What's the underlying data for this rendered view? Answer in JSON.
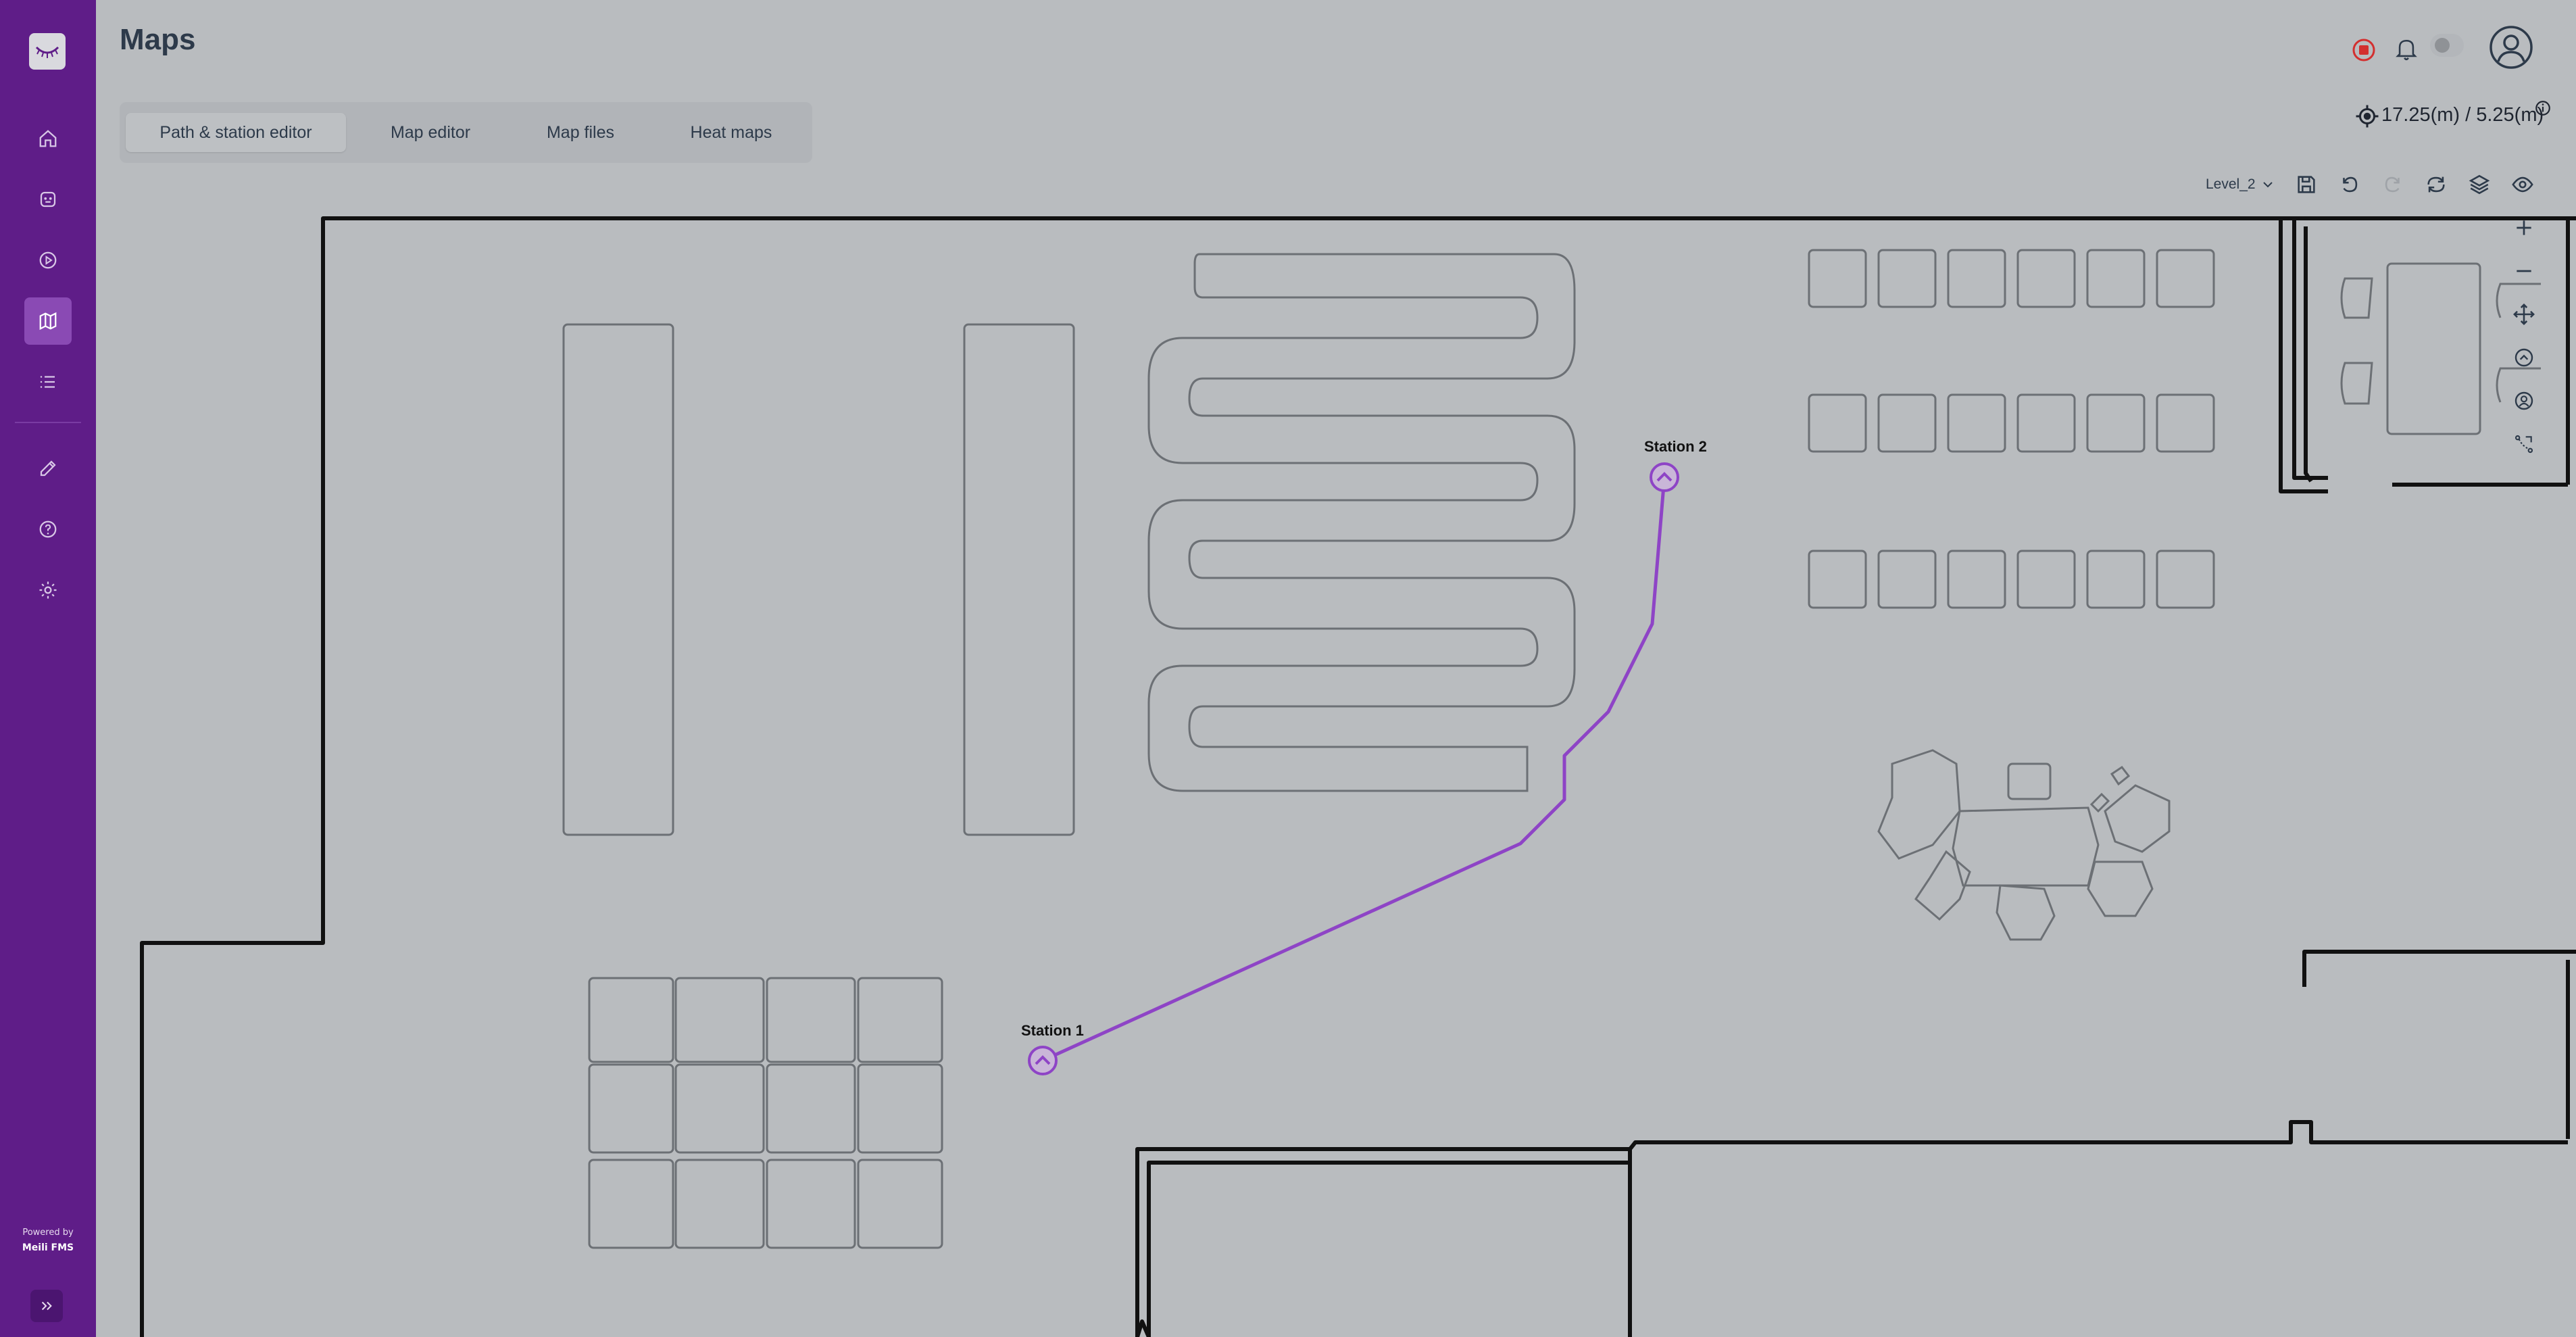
{
  "app": {
    "page_title": "Maps"
  },
  "sidebar": {
    "items": [
      {
        "icon": "home-icon",
        "active": false
      },
      {
        "icon": "robot-icon",
        "active": false
      },
      {
        "icon": "play-icon",
        "active": false
      },
      {
        "icon": "map-icon",
        "active": true
      },
      {
        "icon": "list-icon",
        "active": false
      },
      {
        "icon": "pen-icon",
        "active": false
      },
      {
        "icon": "help-icon",
        "active": false
      },
      {
        "icon": "settings-icon",
        "active": false
      }
    ],
    "powered_by": "Powered by",
    "brand": "Meili FMS"
  },
  "tabs": [
    {
      "label": "Path & station editor",
      "active": true
    },
    {
      "label": "Map editor",
      "active": false
    },
    {
      "label": "Map files",
      "active": false
    },
    {
      "label": "Heat maps",
      "active": false
    }
  ],
  "toolbar": {
    "coordinates": "17.25(m) / 5.25(m)",
    "level": "Level_2",
    "icons": [
      "save-icon",
      "undo-icon",
      "redo-icon",
      "refresh-icon",
      "layers-icon",
      "eye-icon"
    ]
  },
  "zoom_controls": [
    "zoom-in-icon",
    "zoom-out-icon",
    "pan-icon",
    "station-icon",
    "robot-position-icon",
    "path-icon"
  ],
  "stations": [
    {
      "name": "Station 1"
    },
    {
      "name": "Station 2"
    }
  ],
  "colors": {
    "sidebar": "#5f1d88",
    "accent": "#8e44c6",
    "map_background": "#b9bcbf",
    "wall": "#111111",
    "obstacle": "#6c7075"
  }
}
